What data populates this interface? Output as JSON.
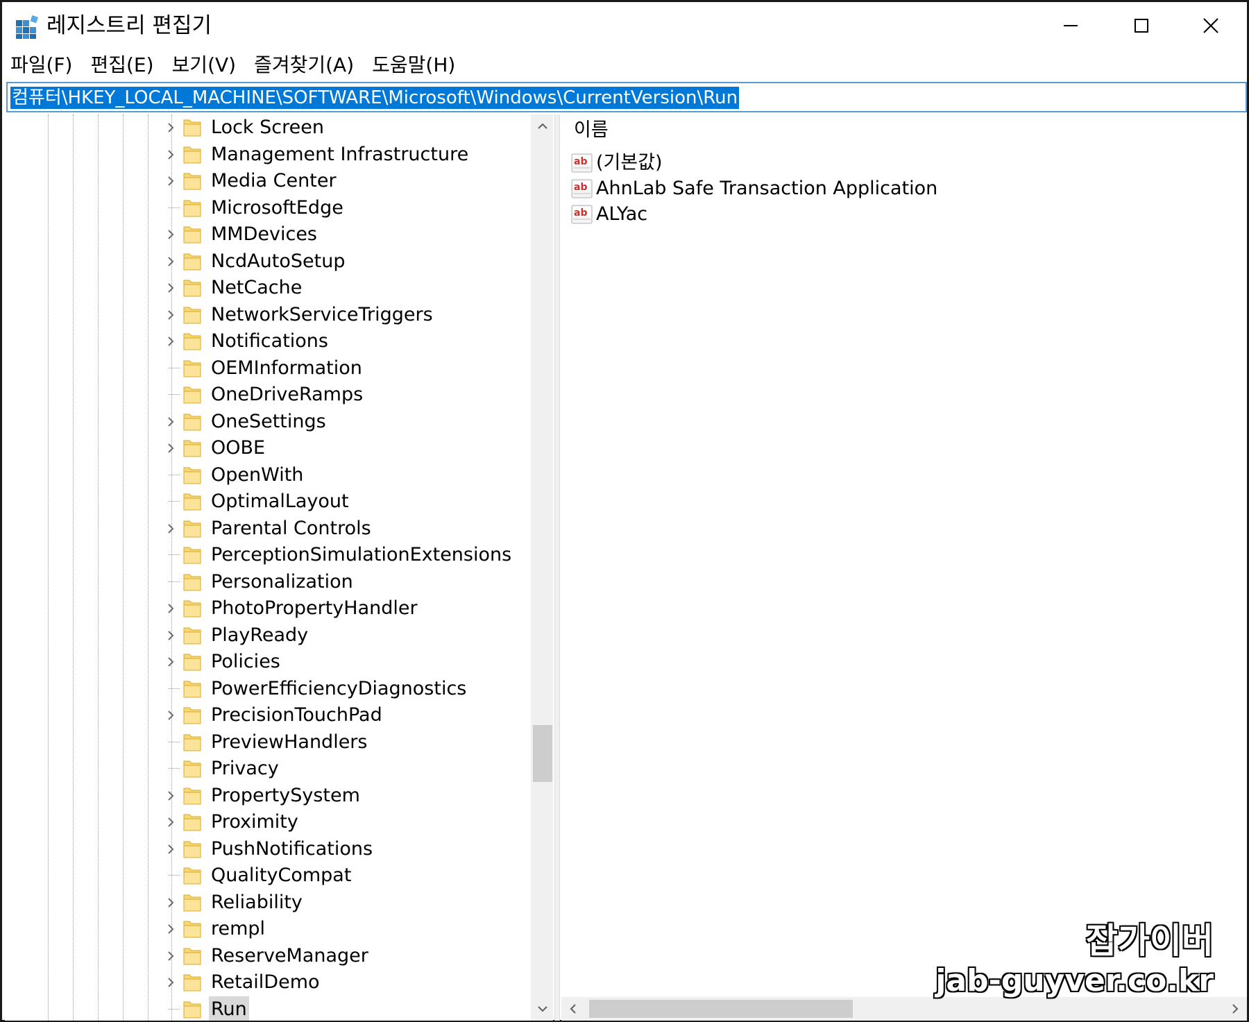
{
  "window": {
    "title": "레지스트리 편집기",
    "controls": {
      "minimize": "minimize-icon",
      "maximize": "maximize-icon",
      "close": "close-icon"
    }
  },
  "menu": {
    "items": [
      {
        "label": "파일(F)"
      },
      {
        "label": "편집(E)"
      },
      {
        "label": "보기(V)"
      },
      {
        "label": "즐겨찾기(A)"
      },
      {
        "label": "도움말(H)"
      }
    ]
  },
  "address": {
    "path": "컴퓨터\\HKEY_LOCAL_MACHINE\\SOFTWARE\\Microsoft\\Windows\\CurrentVersion\\Run"
  },
  "tree": {
    "nodes": [
      {
        "label": "Lock Screen",
        "expandable": true
      },
      {
        "label": "Management Infrastructure",
        "expandable": true
      },
      {
        "label": "Media Center",
        "expandable": true
      },
      {
        "label": "MicrosoftEdge",
        "expandable": false
      },
      {
        "label": "MMDevices",
        "expandable": true
      },
      {
        "label": "NcdAutoSetup",
        "expandable": true
      },
      {
        "label": "NetCache",
        "expandable": true
      },
      {
        "label": "NetworkServiceTriggers",
        "expandable": true
      },
      {
        "label": "Notifications",
        "expandable": true
      },
      {
        "label": "OEMInformation",
        "expandable": false
      },
      {
        "label": "OneDriveRamps",
        "expandable": false
      },
      {
        "label": "OneSettings",
        "expandable": true
      },
      {
        "label": "OOBE",
        "expandable": true
      },
      {
        "label": "OpenWith",
        "expandable": false
      },
      {
        "label": "OptimalLayout",
        "expandable": false
      },
      {
        "label": "Parental Controls",
        "expandable": true
      },
      {
        "label": "PerceptionSimulationExtensions",
        "expandable": false
      },
      {
        "label": "Personalization",
        "expandable": false
      },
      {
        "label": "PhotoPropertyHandler",
        "expandable": true
      },
      {
        "label": "PlayReady",
        "expandable": true
      },
      {
        "label": "Policies",
        "expandable": true
      },
      {
        "label": "PowerEfficiencyDiagnostics",
        "expandable": false
      },
      {
        "label": "PrecisionTouchPad",
        "expandable": true
      },
      {
        "label": "PreviewHandlers",
        "expandable": false
      },
      {
        "label": "Privacy",
        "expandable": false
      },
      {
        "label": "PropertySystem",
        "expandable": true
      },
      {
        "label": "Proximity",
        "expandable": true
      },
      {
        "label": "PushNotifications",
        "expandable": true
      },
      {
        "label": "QualityCompat",
        "expandable": false
      },
      {
        "label": "Reliability",
        "expandable": true
      },
      {
        "label": "rempl",
        "expandable": true
      },
      {
        "label": "ReserveManager",
        "expandable": true
      },
      {
        "label": "RetailDemo",
        "expandable": true
      },
      {
        "label": "Run",
        "expandable": false,
        "selected": true
      }
    ]
  },
  "values": {
    "column_header": "이름",
    "rows": [
      {
        "name": "(기본값)",
        "icon": "string-value-icon"
      },
      {
        "name": "AhnLab Safe Transaction Application",
        "icon": "string-value-icon"
      },
      {
        "name": "ALYac",
        "icon": "string-value-icon"
      }
    ]
  },
  "watermark": {
    "line1": "잡가이버",
    "line2": "jab-guyver.co.kr"
  },
  "colors": {
    "selection_blue": "#0078d7",
    "folder_yellow": "#f8d775",
    "tree_selected_bg": "#d9d9d9",
    "address_border": "#5a9bd5"
  }
}
